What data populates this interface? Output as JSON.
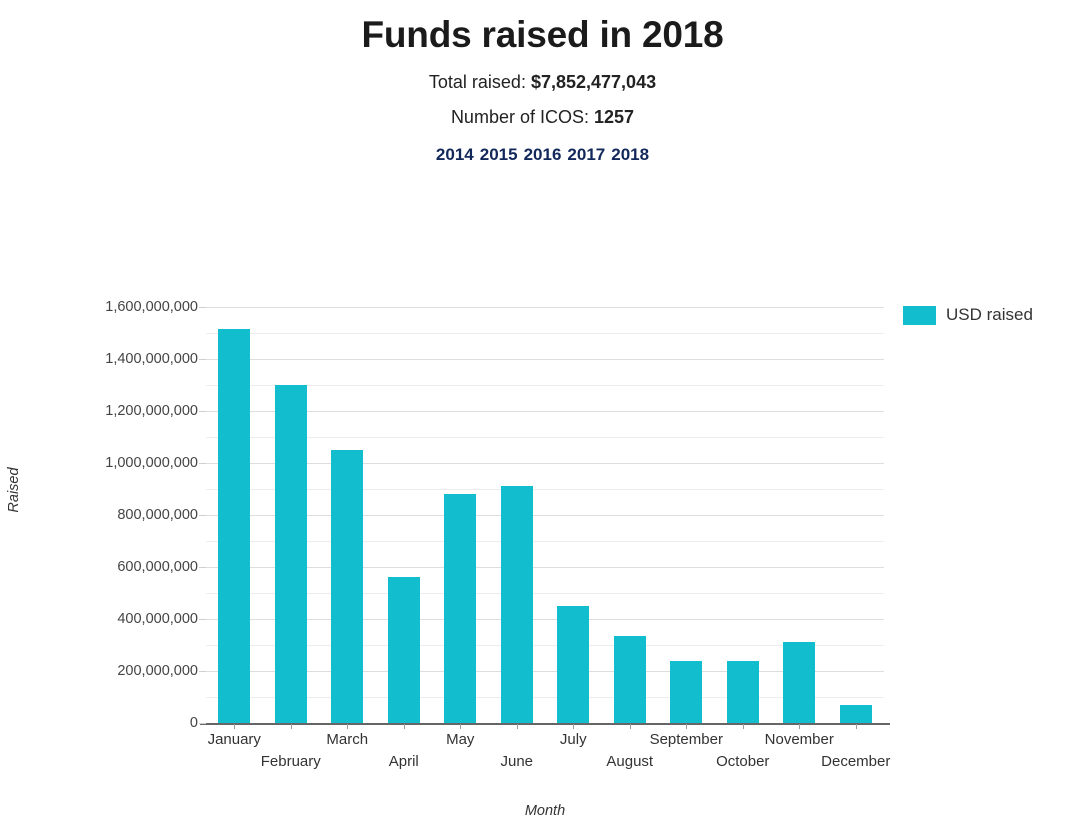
{
  "header": {
    "title": "Funds raised in 2018",
    "total_raised_label": "Total raised:",
    "total_raised_value": "$7,852,477,043",
    "icos_label": "Number of ICOS:",
    "icos_value": "1257",
    "years": [
      {
        "label": "2014"
      },
      {
        "label": "2015"
      },
      {
        "label": "2016"
      },
      {
        "label": "2017"
      },
      {
        "label": "2018"
      }
    ]
  },
  "colors": {
    "bar": "#12becd",
    "year_link": "#13285a",
    "gridline": "#dedede",
    "axis": "#666666"
  },
  "legend": {
    "position": "right",
    "entries": [
      {
        "label": "USD raised",
        "color": "#12becd"
      }
    ]
  },
  "chart_data": {
    "type": "bar",
    "title": "Funds raised in 2018",
    "xlabel": "Month",
    "ylabel": "Raised",
    "ylim": [
      0,
      1600000000
    ],
    "grid": true,
    "categories": [
      "January",
      "February",
      "March",
      "April",
      "May",
      "June",
      "July",
      "August",
      "September",
      "October",
      "November",
      "December"
    ],
    "series": [
      {
        "name": "USD raised",
        "color": "#12becd",
        "values": [
          1515000000,
          1300000000,
          1050000000,
          560000000,
          880000000,
          910000000,
          450000000,
          335000000,
          240000000,
          240000000,
          310000000,
          70000000
        ]
      }
    ],
    "ytick_labels": [
      "0",
      "200,000,000",
      "400,000,000",
      "600,000,000",
      "800,000,000",
      "1,000,000,000",
      "1,200,000,000",
      "1,400,000,000",
      "1,600,000,000"
    ],
    "ytick_values": [
      0,
      200000000,
      400000000,
      600000000,
      800000000,
      1000000000,
      1200000000,
      1400000000,
      1600000000
    ],
    "minor_tick_interval": 100000000
  }
}
